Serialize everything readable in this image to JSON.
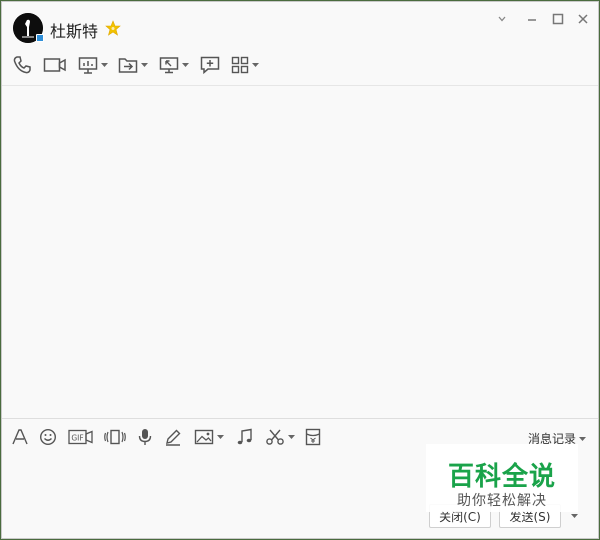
{
  "contact": {
    "name": "杜斯特",
    "starred": true
  },
  "window_controls": [
    "dropdown",
    "minimize",
    "maximize",
    "close"
  ],
  "top_toolbar": [
    {
      "name": "voice-call",
      "icon": "phone-icon",
      "has_menu": false
    },
    {
      "name": "video-call",
      "icon": "video-camera-icon",
      "has_menu": false
    },
    {
      "name": "remote-demo",
      "icon": "presentation-icon",
      "has_menu": true
    },
    {
      "name": "send-file",
      "icon": "folder-arrow-icon",
      "has_menu": true
    },
    {
      "name": "remote-desktop",
      "icon": "monitor-arrow-icon",
      "has_menu": true
    },
    {
      "name": "create-group",
      "icon": "chat-plus-icon",
      "has_menu": false
    },
    {
      "name": "apps",
      "icon": "grid-icon",
      "has_menu": true
    }
  ],
  "bottom_toolbar": [
    {
      "name": "font",
      "icon": "font-icon"
    },
    {
      "name": "emoji",
      "icon": "smiley-icon"
    },
    {
      "name": "gif",
      "icon": "gif-icon",
      "label": "GIF"
    },
    {
      "name": "shake",
      "icon": "shake-icon"
    },
    {
      "name": "voice-message",
      "icon": "microphone-icon"
    },
    {
      "name": "handwriting",
      "icon": "pen-icon"
    },
    {
      "name": "image",
      "icon": "image-icon",
      "has_menu": true
    },
    {
      "name": "music",
      "icon": "music-note-icon"
    },
    {
      "name": "screenshot",
      "icon": "scissors-icon",
      "has_menu": true
    },
    {
      "name": "red-packet",
      "icon": "red-packet-icon"
    }
  ],
  "history_label": "消息记录",
  "buttons": {
    "close_label": "关闭(C)",
    "send_label": "发送(S)"
  },
  "watermark": {
    "title": "百科全说",
    "subtitle": "助你轻松解决"
  },
  "colors": {
    "accent": "#1aa34a",
    "icon": "#555555",
    "background": "#f9f9f9",
    "star": "#f2c200"
  }
}
